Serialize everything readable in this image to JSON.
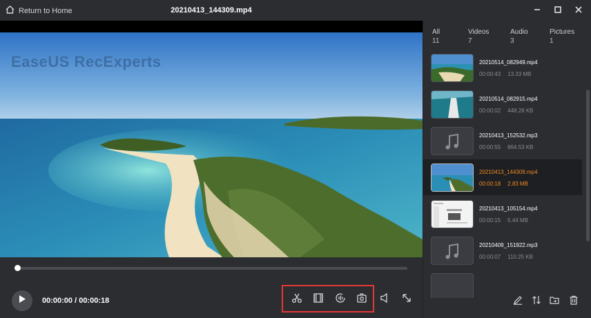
{
  "app": {
    "return_home": "Return to Home",
    "file_title": "20210413_144309.mp4",
    "watermark": "EaseUS RecExperts"
  },
  "player": {
    "current_time": "00:00:00",
    "separator": " / ",
    "total_time": "00:00:18",
    "time_display": "00:00:00 / 00:00:18",
    "progress_fraction": 0.0
  },
  "tabs": [
    {
      "label": "All",
      "count": "11"
    },
    {
      "label": "Videos",
      "count": "7"
    },
    {
      "label": "Audio",
      "count": "3"
    },
    {
      "label": "Pictures",
      "count": "1"
    }
  ],
  "files": [
    {
      "name": "20210514_082949.mp4",
      "duration": "00:00:43",
      "size": "13.33 MB",
      "thumb": "beach-video",
      "active": false
    },
    {
      "name": "20210514_082915.mp4",
      "duration": "00:00:02",
      "size": "448.28 KB",
      "thumb": "boat-video",
      "active": false
    },
    {
      "name": "20210413_152532.mp3",
      "duration": "00:00:55",
      "size": "864.53 KB",
      "thumb": "music-note",
      "active": false
    },
    {
      "name": "20210413_144309.mp4",
      "duration": "00:00:18",
      "size": "2.83 MB",
      "thumb": "beach-video",
      "active": true
    },
    {
      "name": "20210413_105154.mp4",
      "duration": "00:00:15",
      "size": "5.44 MB",
      "thumb": "screen-capture",
      "active": false
    },
    {
      "name": "20210409_151922.mp3",
      "duration": "00:00:07",
      "size": "110.25 KB",
      "thumb": "music-note",
      "active": false
    }
  ],
  "colors": {
    "background": "#2b2d31",
    "active_row": "#1e1f22",
    "accent_orange": "#f08a24",
    "highlight_box": "#e53935"
  },
  "icons": {
    "home": "home-icon",
    "minimize": "minimize-icon",
    "maximize": "maximize-icon",
    "close": "close-icon",
    "play": "play-icon",
    "trim": "scissors-icon",
    "extract_frames": "film-icon",
    "audio": "audio-wave-icon",
    "screenshot": "camera-icon",
    "volume": "speaker-icon",
    "fullscreen": "expand-icon",
    "rename": "pen-icon",
    "sort": "sort-icon",
    "open_folder": "folder-icon",
    "delete": "trash-icon"
  }
}
